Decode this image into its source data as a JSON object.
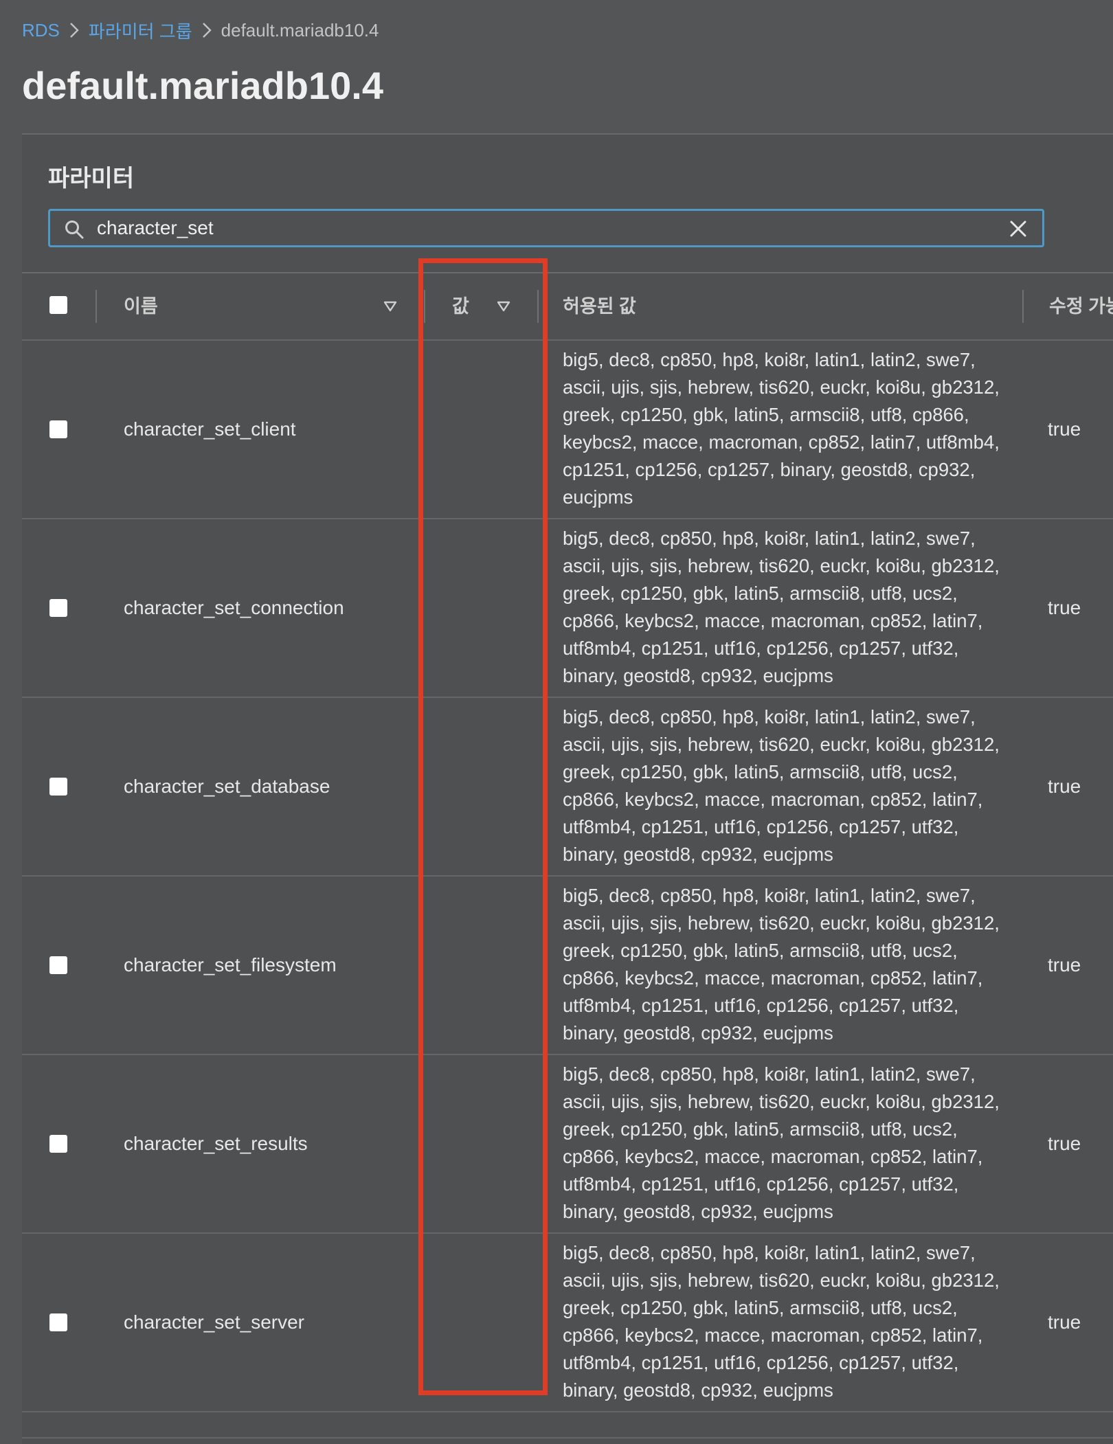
{
  "breadcrumb": {
    "root": "RDS",
    "parent": "파라미터 그룹",
    "current": "default.mariadb10.4"
  },
  "page_title": "default.mariadb10.4",
  "panel": {
    "title": "파라미터",
    "search": {
      "value": "character_set",
      "placeholder": ""
    }
  },
  "table": {
    "columns": {
      "name": "이름",
      "value": "값",
      "allowed": "허용된 값",
      "editable": "수정 가능"
    },
    "rows": [
      {
        "name": "character_set_client",
        "value": "",
        "allowed": "big5, dec8, cp850, hp8, koi8r, latin1, latin2, swe7, ascii, ujis, sjis, hebrew, tis620, euckr, koi8u, gb2312, greek, cp1250, gbk, latin5, armscii8, utf8, cp866, keybcs2, macce, macroman, cp852, latin7, utf8mb4, cp1251, cp1256, cp1257, binary, geostd8, cp932, eucjpms",
        "editable": "true"
      },
      {
        "name": "character_set_connection",
        "value": "",
        "allowed": "big5, dec8, cp850, hp8, koi8r, latin1, latin2, swe7, ascii, ujis, sjis, hebrew, tis620, euckr, koi8u, gb2312, greek, cp1250, gbk, latin5, armscii8, utf8, ucs2, cp866, keybcs2, macce, macroman, cp852, latin7, utf8mb4, cp1251, utf16, cp1256, cp1257, utf32, binary, geostd8, cp932, eucjpms",
        "editable": "true"
      },
      {
        "name": "character_set_database",
        "value": "",
        "allowed": "big5, dec8, cp850, hp8, koi8r, latin1, latin2, swe7, ascii, ujis, sjis, hebrew, tis620, euckr, koi8u, gb2312, greek, cp1250, gbk, latin5, armscii8, utf8, ucs2, cp866, keybcs2, macce, macroman, cp852, latin7, utf8mb4, cp1251, utf16, cp1256, cp1257, utf32, binary, geostd8, cp932, eucjpms",
        "editable": "true"
      },
      {
        "name": "character_set_filesystem",
        "value": "",
        "allowed": "big5, dec8, cp850, hp8, koi8r, latin1, latin2, swe7, ascii, ujis, sjis, hebrew, tis620, euckr, koi8u, gb2312, greek, cp1250, gbk, latin5, armscii8, utf8, ucs2, cp866, keybcs2, macce, macroman, cp852, latin7, utf8mb4, cp1251, utf16, cp1256, cp1257, utf32, binary, geostd8, cp932, eucjpms",
        "editable": "true"
      },
      {
        "name": "character_set_results",
        "value": "",
        "allowed": "big5, dec8, cp850, hp8, koi8r, latin1, latin2, swe7, ascii, ujis, sjis, hebrew, tis620, euckr, koi8u, gb2312, greek, cp1250, gbk, latin5, armscii8, utf8, ucs2, cp866, keybcs2, macce, macroman, cp852, latin7, utf8mb4, cp1251, utf16, cp1256, cp1257, utf32, binary, geostd8, cp932, eucjpms",
        "editable": "true"
      },
      {
        "name": "character_set_server",
        "value": "",
        "allowed": "big5, dec8, cp850, hp8, koi8r, latin1, latin2, swe7, ascii, ujis, sjis, hebrew, tis620, euckr, koi8u, gb2312, greek, cp1250, gbk, latin5, armscii8, utf8, ucs2, cp866, keybcs2, macce, macroman, cp852, latin7, utf8mb4, cp1251, utf16, cp1256, cp1257, utf32, binary, geostd8, cp932, eucjpms",
        "editable": "true"
      }
    ]
  },
  "icons": {
    "search": "search-icon",
    "clear": "close-icon",
    "sort": "sort-caret-down-icon",
    "separator": "chevron-right-icon"
  },
  "colors": {
    "link": "#5aa6e8",
    "search_border": "#4f9ac4",
    "highlight": "#e03c26",
    "background": "#545556"
  }
}
